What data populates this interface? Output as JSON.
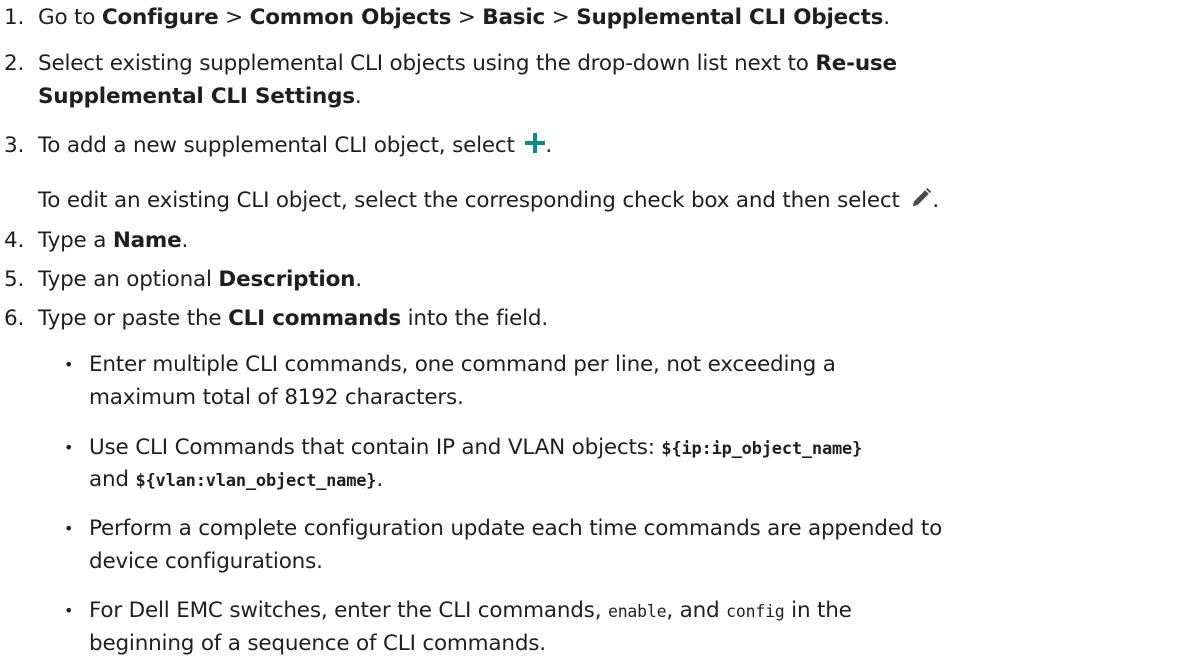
{
  "steps": [
    {
      "num": "1.",
      "a": "Go to ",
      "b1": "Configure",
      "s1": " > ",
      "b2": "Common Objects",
      "s2": " > ",
      "b3": "Basic",
      "s3": " > ",
      "b4": "Supplemental CLI Objects",
      "end": "."
    },
    {
      "num": "2.",
      "line1": "Select existing supplemental CLI objects using the drop-down list next to ",
      "b1": "Re-use",
      "b2": "Supplemental CLI Settings",
      "end": "."
    },
    {
      "num": "3.",
      "text": "To add a new supplemental CLI object, select ",
      "end": ".",
      "icon": "plus-icon",
      "color": "#0b8a8c"
    },
    {
      "text": "To edit an existing CLI object, select the corresponding check box and then select ",
      "end": ".",
      "icon": "pencil-icon"
    },
    {
      "num": "4.",
      "a": "Type a ",
      "b": "Name",
      "end": "."
    },
    {
      "num": "5.",
      "a": "Type an optional ",
      "b": "Description",
      "end": "."
    },
    {
      "num": "6.",
      "a": "Type or paste the ",
      "b": "CLI commands",
      "end": " into the field."
    }
  ],
  "bullets": [
    {
      "line1": "Enter multiple CLI commands, one command per line, not exceeding a",
      "line2": "maximum total of 8192 characters."
    },
    {
      "line1": "Use CLI Commands that contain IP and VLAN objects: ",
      "code1": "${ip:ip_object_name}",
      "and": "and ",
      "code2": "${vlan:vlan_object_name}",
      "end": "."
    },
    {
      "line1": "Perform a complete configuration update each time commands are appended to",
      "line2": "device configurations."
    },
    {
      "a": "For Dell EMC switches, enter the CLI commands, ",
      "code1": "enable",
      "b": ", and ",
      "code2": "config",
      "c": " in the",
      "line2": "beginning of a sequence of CLI commands."
    }
  ],
  "bullet_char": "•"
}
